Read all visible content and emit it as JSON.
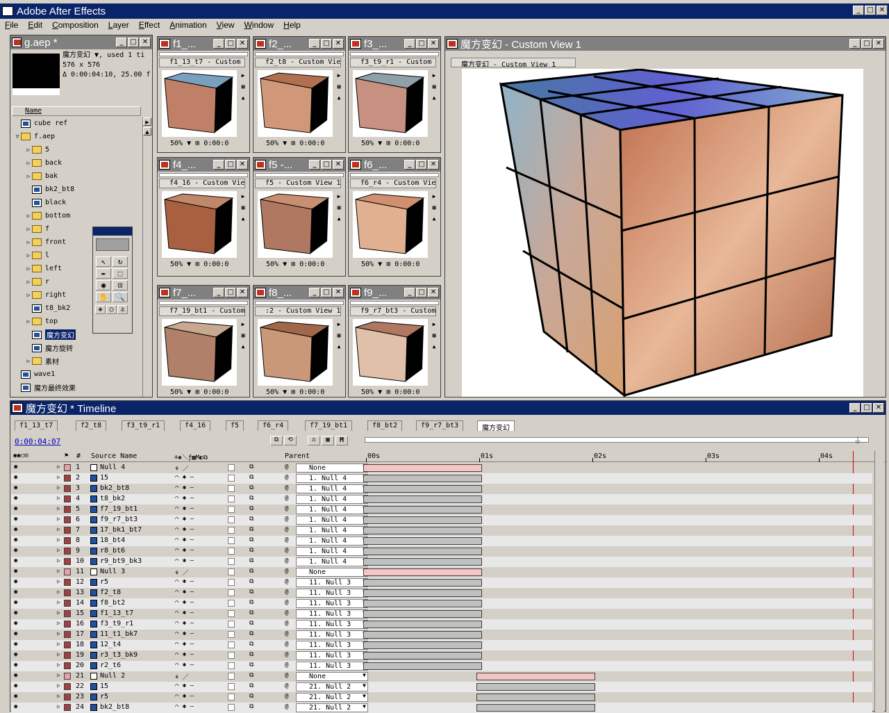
{
  "app": {
    "title": "Adobe After Effects"
  },
  "menu": [
    "File",
    "Edit",
    "Composition",
    "Layer",
    "Effect",
    "Animation",
    "View",
    "Window",
    "Help"
  ],
  "project": {
    "title": "g.aep *",
    "info_name": "魔方变幻 ▼, used 1 ti",
    "info_size": "576 x 576",
    "info_dur": "Δ 0:00:04:10, 25.00 f",
    "col_name": "Name",
    "items": [
      {
        "label": "cube ref",
        "type": "comp",
        "depth": 0,
        "tri": ""
      },
      {
        "label": "f.aep",
        "type": "folder",
        "depth": 0,
        "tri": "▽"
      },
      {
        "label": "5",
        "type": "folder",
        "depth": 1,
        "tri": "▷"
      },
      {
        "label": "back",
        "type": "folder",
        "depth": 1,
        "tri": "▷"
      },
      {
        "label": "bak",
        "type": "folder",
        "depth": 1,
        "tri": "▷"
      },
      {
        "label": "bk2_bt8",
        "type": "comp",
        "depth": 1,
        "tri": ""
      },
      {
        "label": "black",
        "type": "comp",
        "depth": 1,
        "tri": ""
      },
      {
        "label": "bottom",
        "type": "folder",
        "depth": 1,
        "tri": "▷"
      },
      {
        "label": "f",
        "type": "folder",
        "depth": 1,
        "tri": "▷"
      },
      {
        "label": "front",
        "type": "folder",
        "depth": 1,
        "tri": "▷"
      },
      {
        "label": "l",
        "type": "folder",
        "depth": 1,
        "tri": "▷"
      },
      {
        "label": "left",
        "type": "folder",
        "depth": 1,
        "tri": "▷"
      },
      {
        "label": "r",
        "type": "folder",
        "depth": 1,
        "tri": "▷"
      },
      {
        "label": "right",
        "type": "folder",
        "depth": 1,
        "tri": "▷"
      },
      {
        "label": "t8_bk2",
        "type": "comp",
        "depth": 1,
        "tri": ""
      },
      {
        "label": "top",
        "type": "folder",
        "depth": 1,
        "tri": "▷"
      },
      {
        "label": "魔方变幻",
        "type": "comp",
        "depth": 1,
        "tri": "",
        "selected": true
      },
      {
        "label": "魔方旋转",
        "type": "comp",
        "depth": 1,
        "tri": ""
      },
      {
        "label": "素材",
        "type": "folder",
        "depth": 1,
        "tri": "▷"
      },
      {
        "label": "wave1",
        "type": "comp",
        "depth": 0,
        "tri": ""
      },
      {
        "label": "魔方最终效果",
        "type": "comp",
        "depth": 0,
        "tri": ""
      }
    ]
  },
  "thumbs": [
    {
      "title": "f1_...",
      "tab": "f1_13_t7 - Custom",
      "zoom": "50%",
      "time": "0:00:0"
    },
    {
      "title": "f2_...",
      "tab": "f2_t8 - Custom Vie",
      "zoom": "50%",
      "time": "0:00:0"
    },
    {
      "title": "f3_...",
      "tab": "f3_t9_r1 - Custom V",
      "zoom": "50%",
      "time": "0:00:0"
    },
    {
      "title": "f4_...",
      "tab": "f4_16 - Custom View",
      "zoom": "50%",
      "time": "0:00:0"
    },
    {
      "title": "f5 -...",
      "tab": "f5 - Custom View 1",
      "zoom": "50%",
      "time": "0:00:0"
    },
    {
      "title": "f6_...",
      "tab": "f6_r4 - Custom View",
      "zoom": "50%",
      "time": "0:00:0"
    },
    {
      "title": "f7_...",
      "tab": "f7_19_bt1 - Custom",
      "zoom": "50%",
      "time": "0:00:0"
    },
    {
      "title": "f8_...",
      "tab": ":2 - Custom View 1",
      "zoom": "50%",
      "time": "0:00:0"
    },
    {
      "title": "f9_...",
      "tab": "f9_r7_bt3 - Custom",
      "zoom": "50%",
      "time": "0:00:0"
    }
  ],
  "viewer": {
    "title": "魔方变幻 - Custom View 1",
    "tab": "魔方变幻 - Custom View 1"
  },
  "timeline": {
    "title": "魔方变幻 * Timeline",
    "current_time": "0:00:04:07",
    "tabs": [
      "f1_13_t7",
      "f2_t8",
      "f3_t9_r1",
      "f4_16",
      "f5",
      "f6_r4",
      "f7_19_bt1",
      "f8_bt2",
      "f9_r7_bt3",
      "魔方变幻"
    ],
    "col_num": "#",
    "col_source": "Source Name",
    "col_parent": "Parent",
    "ruler": [
      "00s",
      "01s",
      "02s",
      "03s",
      "04s"
    ],
    "layers": [
      {
        "num": "1",
        "name": "Null 4",
        "parent": "None",
        "null": true,
        "start": 0,
        "end": 1.05
      },
      {
        "num": "2",
        "name": "15",
        "parent": "1. Null 4",
        "start": 0,
        "end": 1.05
      },
      {
        "num": "3",
        "name": "bk2_bt8",
        "parent": "1. Null 4",
        "start": 0,
        "end": 1.05
      },
      {
        "num": "4",
        "name": "t8_bk2",
        "parent": "1. Null 4",
        "start": 0,
        "end": 1.05
      },
      {
        "num": "5",
        "name": "f7_19_bt1",
        "parent": "1. Null 4",
        "start": 0,
        "end": 1.05
      },
      {
        "num": "6",
        "name": "f9_r7_bt3",
        "parent": "1. Null 4",
        "start": 0,
        "end": 1.05
      },
      {
        "num": "7",
        "name": "17_bk1_bt7",
        "parent": "1. Null 4",
        "start": 0,
        "end": 1.05
      },
      {
        "num": "8",
        "name": "18_bt4",
        "parent": "1. Null 4",
        "start": 0,
        "end": 1.05
      },
      {
        "num": "9",
        "name": "r8_bt6",
        "parent": "1. Null 4",
        "start": 0,
        "end": 1.05
      },
      {
        "num": "10",
        "name": "r9_bt9_bk3",
        "parent": "1. Null 4",
        "start": 0,
        "end": 1.05
      },
      {
        "num": "11",
        "name": "Null 3",
        "parent": "None",
        "null": true,
        "start": 0,
        "end": 1.05
      },
      {
        "num": "12",
        "name": "r5",
        "parent": "11. Null 3",
        "start": 0,
        "end": 1.05
      },
      {
        "num": "13",
        "name": "f2_t8",
        "parent": "11. Null 3",
        "start": 0,
        "end": 1.05
      },
      {
        "num": "14",
        "name": "f8_bt2",
        "parent": "11. Null 3",
        "start": 0,
        "end": 1.05
      },
      {
        "num": "15",
        "name": "f1_13_t7",
        "parent": "11. Null 3",
        "start": 0,
        "end": 1.05
      },
      {
        "num": "16",
        "name": "f3_t9_r1",
        "parent": "11. Null 3",
        "start": 0,
        "end": 1.05
      },
      {
        "num": "17",
        "name": "11_t1_bk7",
        "parent": "11. Null 3",
        "start": 0,
        "end": 1.05
      },
      {
        "num": "18",
        "name": "12_t4",
        "parent": "11. Null 3",
        "start": 0,
        "end": 1.05
      },
      {
        "num": "19",
        "name": "r3_t3_bk9",
        "parent": "11. Null 3",
        "start": 0,
        "end": 1.05
      },
      {
        "num": "20",
        "name": "r2_t6",
        "parent": "11. Null 3",
        "start": 0,
        "end": 1.05
      },
      {
        "num": "21",
        "name": "Null 2",
        "parent": "None",
        "null": true,
        "start": 1.0,
        "end": 2.05
      },
      {
        "num": "22",
        "name": "15",
        "parent": "21. Null 2",
        "start": 1.0,
        "end": 2.05
      },
      {
        "num": "23",
        "name": "r5",
        "parent": "21. Null 2",
        "start": 1.0,
        "end": 2.05
      },
      {
        "num": "24",
        "name": "bk2_bt8",
        "parent": "21. Null 2",
        "start": 1.0,
        "end": 2.05
      }
    ]
  },
  "colors": {
    "title_active": "#0a246a",
    "title_inactive": "#808080",
    "face": "#d4d0c8",
    "null_bar": "#f5c5c5",
    "bar": "#c0c0c0"
  }
}
